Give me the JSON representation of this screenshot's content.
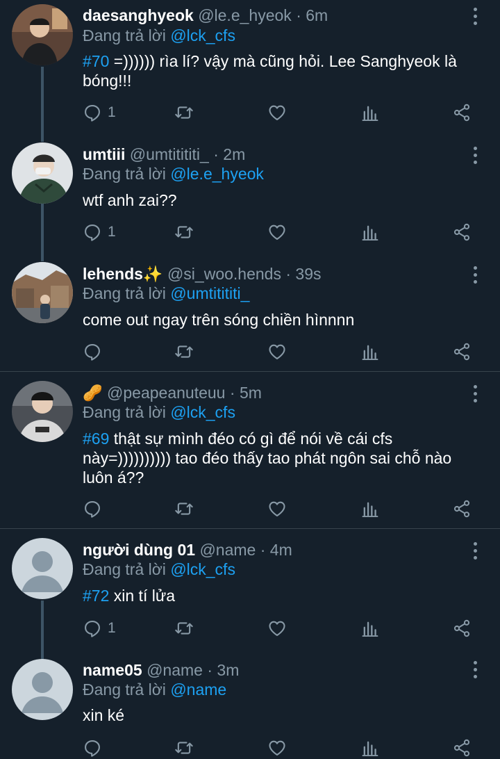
{
  "colors": {
    "background": "#15202b",
    "accent": "#1da1f2",
    "muted": "#8899a6",
    "divider": "#38444d"
  },
  "tweets": [
    {
      "name": "daesanghyeok",
      "name_emoji": "",
      "handle": "@le.e_hyeok",
      "time": "6m",
      "reply_prefix": "Đang trả lời",
      "reply_to": "@lck_cfs",
      "tag": "#70",
      "text": " =)))))) rìa lí? vậy mà cũng hỏi. Lee Sanghyeok là bóng!!!",
      "reply_count": "1",
      "icons": [
        "reply-icon",
        "retweet-icon",
        "like-icon",
        "stats-icon",
        "share-icon"
      ]
    },
    {
      "name": "umtiii",
      "name_emoji": "",
      "handle": "@umtitititi_",
      "time": "2m",
      "reply_prefix": "Đang trả lời",
      "reply_to": "@le.e_hyeok",
      "tag": "",
      "text": "wtf anh zai??",
      "reply_count": "1"
    },
    {
      "name": "lehends",
      "name_emoji": "✨",
      "handle": "@si_woo.hends",
      "time": "39s",
      "reply_prefix": "Đang trả lời",
      "reply_to": "@umtitititi_",
      "tag": "",
      "text": "come out ngay trên sóng chiền hìnnnn",
      "reply_count": ""
    },
    {
      "name": "",
      "name_emoji": "🥜",
      "handle": "@peapeanuteuu",
      "time": "5m",
      "reply_prefix": "Đang trả lời",
      "reply_to": "@lck_cfs",
      "tag": "#69",
      "text": " thật sự mình đéo có gì để nói về cái cfs này=)))))))))) tao đéo thấy tao phát ngôn sai chỗ nào luôn á??",
      "reply_count": ""
    },
    {
      "name": "người dùng 01",
      "name_emoji": "",
      "handle": "@name",
      "time": "4m",
      "reply_prefix": "Đang trả lời",
      "reply_to": "@lck_cfs",
      "tag": "#72",
      "text": " xin tí lửa",
      "reply_count": "1"
    },
    {
      "name": "name05",
      "name_emoji": "",
      "handle": "@name",
      "time": "3m",
      "reply_prefix": "Đang trả lời",
      "reply_to": "@name",
      "tag": "",
      "text": "xin ké",
      "reply_count": ""
    }
  ],
  "separator": "·"
}
